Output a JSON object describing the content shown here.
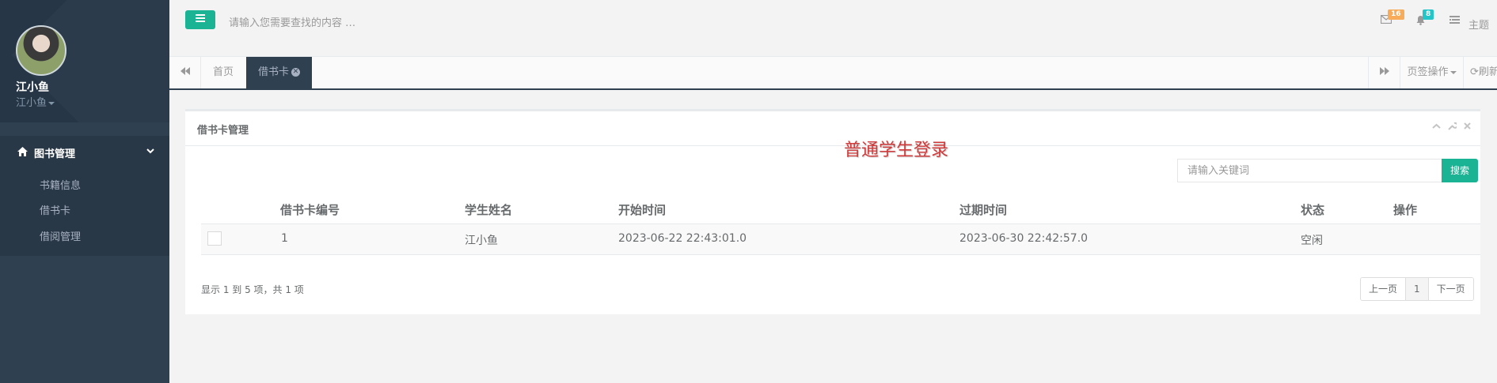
{
  "user": {
    "name": "江小鱼",
    "role": "江小鱼"
  },
  "sidebar": {
    "group": {
      "label": "图书管理"
    },
    "items": [
      {
        "label": "书籍信息"
      },
      {
        "label": "借书卡"
      },
      {
        "label": "借阅管理"
      }
    ]
  },
  "topbar": {
    "search_placeholder": "请输入您需要查找的内容 …",
    "mail_count": "16",
    "bell_count": "8",
    "theme_label": "主题"
  },
  "tabs": {
    "items": [
      {
        "label": "首页"
      },
      {
        "label": "借书卡"
      }
    ],
    "ops_label": "页签操作",
    "refresh_label": "刷新"
  },
  "panel": {
    "title": "借书卡管理",
    "watermark": "普通学生登录",
    "keyword_placeholder": "请输入关键词",
    "search_button": "搜索"
  },
  "table": {
    "headers": [
      "借书卡编号",
      "学生姓名",
      "开始时间",
      "过期时间",
      "状态",
      "操作"
    ],
    "rows": [
      {
        "id": "1",
        "name": "江小鱼",
        "start": "2023-06-22 22:43:01.0",
        "expire": "2023-06-30 22:42:57.0",
        "status": "空闲",
        "ops": ""
      }
    ]
  },
  "pagination": {
    "info": "显示 1 到 5 项，共 1 项",
    "prev": "上一页",
    "current": "1",
    "next": "下一页"
  },
  "colors": {
    "sidebar_bg": "#2f4050",
    "accent_green": "#1ab394",
    "badge_orange": "#f8ac59",
    "badge_teal": "#23c6c8",
    "watermark_red": "#d03a3a"
  }
}
